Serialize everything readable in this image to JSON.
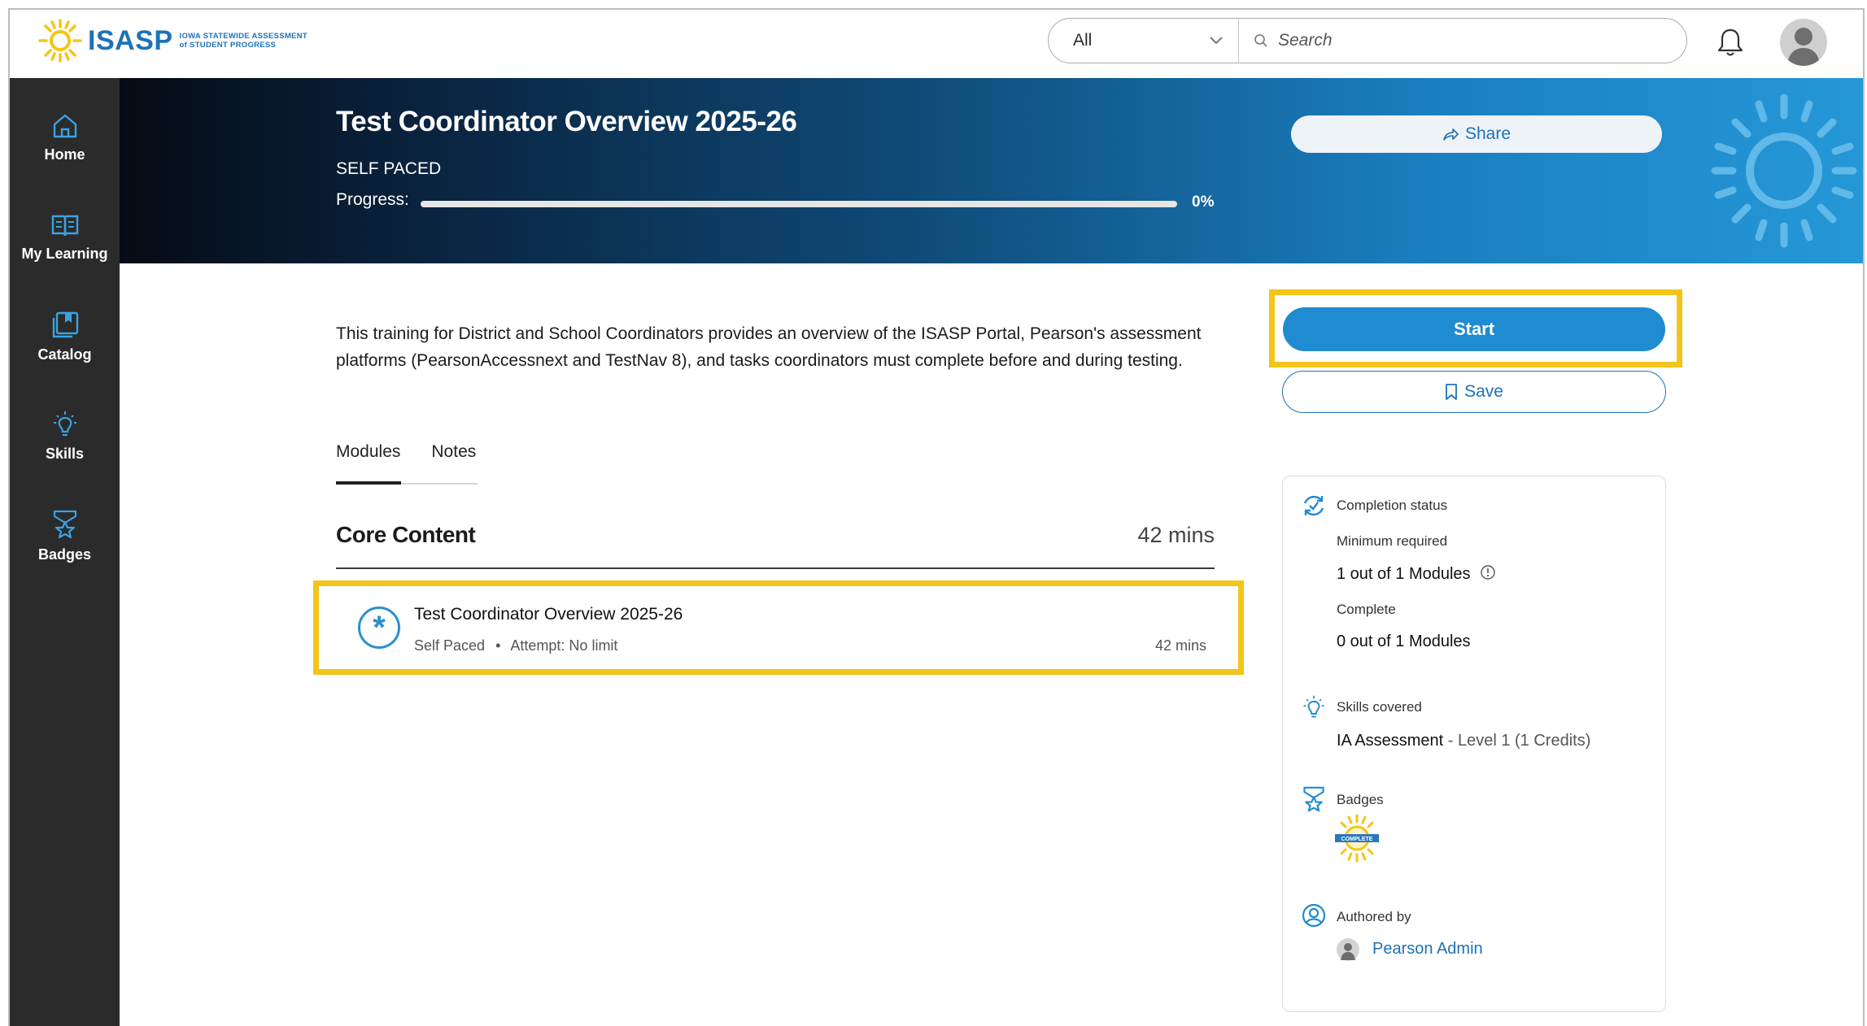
{
  "header": {
    "logo_text": "ISASP",
    "logo_subtitle_line1": "IOWA STATEWIDE ASSESSMENT",
    "logo_subtitle_line2": "of STUDENT PROGRESS",
    "search_scope": "All",
    "search_placeholder": "Search"
  },
  "sidebar": {
    "items": [
      {
        "label": "Home",
        "icon": "home-icon"
      },
      {
        "label": "My Learning",
        "icon": "book-icon"
      },
      {
        "label": "Catalog",
        "icon": "catalog-icon"
      },
      {
        "label": "Skills",
        "icon": "lightbulb-icon"
      },
      {
        "label": "Badges",
        "icon": "badge-icon"
      }
    ]
  },
  "course": {
    "title": "Test Coordinator Overview 2025-26",
    "type": "SELF PACED",
    "progress_label": "Progress:",
    "progress_percent": 0,
    "progress_text": "0%",
    "share_label": "Share",
    "description": "This training for District and School Coordinators provides an overview of the ISASP Portal, Pearson's assessment platforms (PearsonAccessnext and TestNav 8), and tasks coordinators must complete before and during testing.",
    "start_label": "Start",
    "save_label": "Save"
  },
  "tabs": [
    {
      "label": "Modules",
      "active": true
    },
    {
      "label": "Notes",
      "active": false
    }
  ],
  "section": {
    "title": "Core Content",
    "duration": "42 mins"
  },
  "module": {
    "title": "Test Coordinator Overview 2025-26",
    "type": "Self Paced",
    "attempt": "Attempt: No limit",
    "duration": "42 mins"
  },
  "info": {
    "completion_label": "Completion status",
    "min_required_label": "Minimum required",
    "min_required_value": "1 out of 1 Modules",
    "complete_label": "Complete",
    "complete_value": "0 out of 1 Modules",
    "skills_label": "Skills covered",
    "skill_name": "IA Assessment",
    "skill_level": "Level 1 (1 Credits)",
    "badges_label": "Badges",
    "badge_image_text": "COMPLETE",
    "authored_label": "Authored by",
    "author_name": "Pearson Admin"
  },
  "colors": {
    "accent": "#1f8bd0",
    "highlight": "#f3c419",
    "sidebar": "#2b2b2b",
    "link": "#1c72b8"
  }
}
